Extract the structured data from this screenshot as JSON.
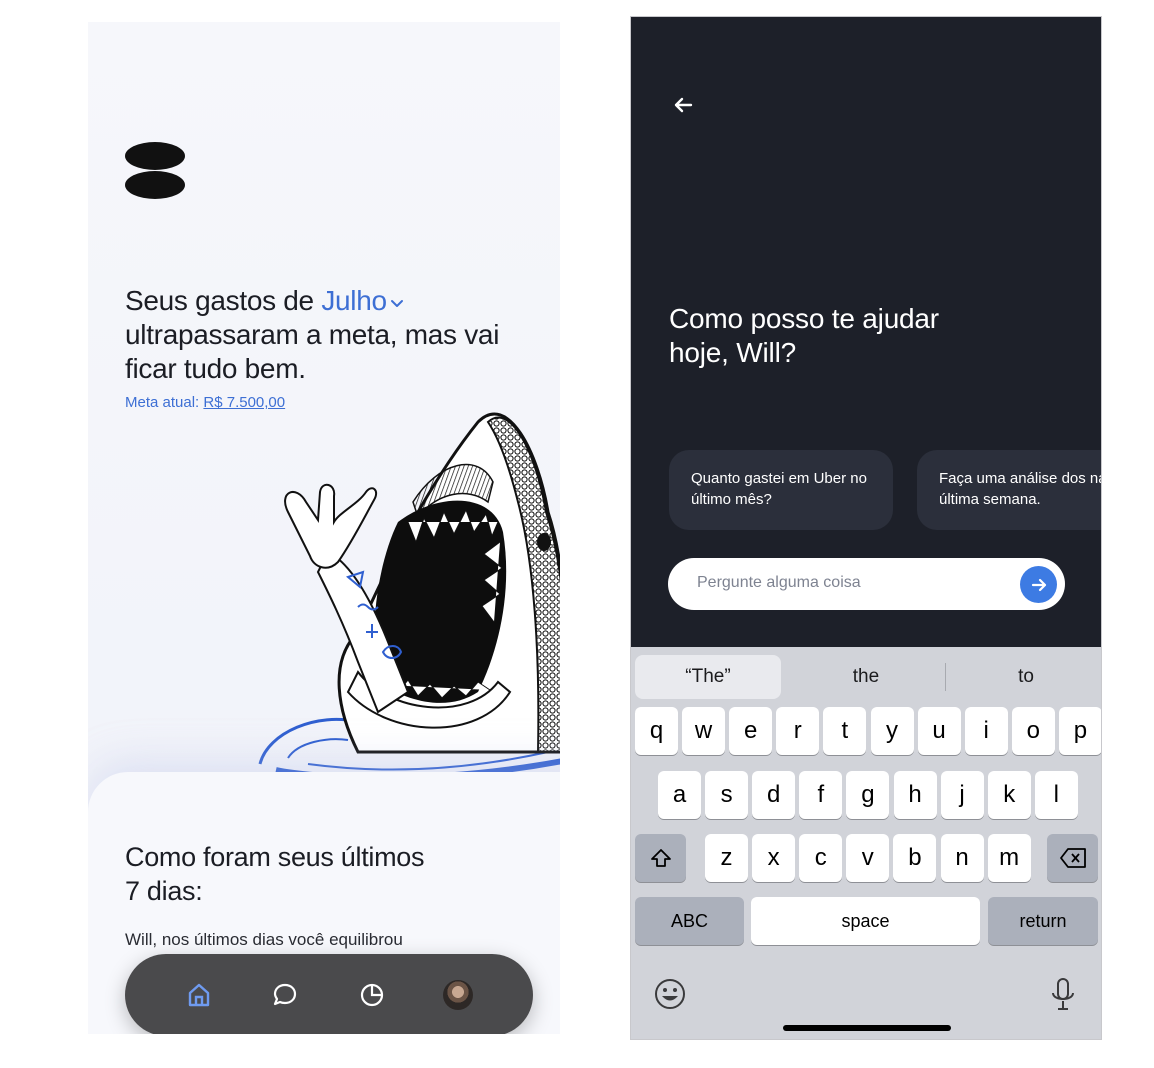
{
  "left_screen": {
    "headline_prefix": "Seus gastos de ",
    "month": "Julho",
    "headline_suffix": "ultrapassaram a meta, mas vai ficar tudo bem.",
    "meta_label": "Meta atual: ",
    "meta_value": "R$ 7.500,00",
    "card_title": "Como foram seus últimos 7 dias:",
    "card_text": "Will, nos últimos dias você equilibrou",
    "nav": {
      "items": [
        {
          "name": "home",
          "icon": "home-icon",
          "active": true
        },
        {
          "name": "chat",
          "icon": "chat-icon",
          "active": false
        },
        {
          "name": "reports",
          "icon": "pie-chart-icon",
          "active": false
        },
        {
          "name": "profile",
          "icon": "avatar",
          "active": false
        }
      ]
    },
    "colors": {
      "accent": "#3d6fd4",
      "nav_bg": "#4a4a4c"
    }
  },
  "right_screen": {
    "greeting": "Como posso te ajudar hoje, Will?",
    "suggestions": [
      "Quanto gastei em Uber no último mês?",
      "Faça uma análise dos na última semana."
    ],
    "input_placeholder": "Pergunte alguma coisa",
    "keyboard": {
      "predictions": [
        "“The”",
        "the",
        "to"
      ],
      "row1": [
        "q",
        "w",
        "e",
        "r",
        "t",
        "y",
        "u",
        "i",
        "o",
        "p"
      ],
      "row2": [
        "a",
        "s",
        "d",
        "f",
        "g",
        "h",
        "j",
        "k",
        "l"
      ],
      "row3": [
        "z",
        "x",
        "c",
        "v",
        "b",
        "n",
        "m"
      ],
      "abc_label": "ABC",
      "space_label": "space",
      "return_label": "return"
    },
    "colors": {
      "background": "#1d2029",
      "chip": "#2b2f3b",
      "send": "#3d7be3"
    }
  }
}
